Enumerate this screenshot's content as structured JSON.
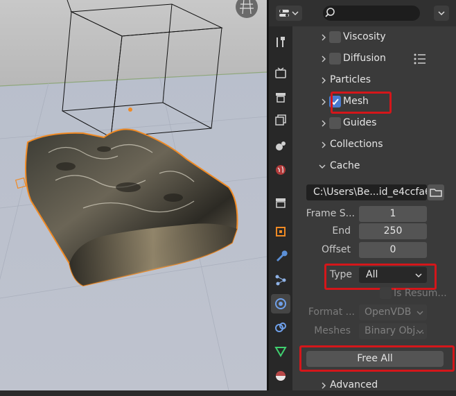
{
  "panel": {
    "sections": [
      {
        "label": "Viscosity",
        "checkbox": true
      },
      {
        "label": "Diffusion",
        "checkbox": true
      },
      {
        "label": "Particles",
        "checkbox": false
      },
      {
        "label": "Mesh",
        "checkbox": true,
        "checked": true
      },
      {
        "label": "Guides",
        "checkbox": true
      },
      {
        "label": "Collections",
        "checkbox": false
      },
      {
        "label": "Cache",
        "checkbox": false,
        "expanded": true
      }
    ],
    "cache": {
      "path": "C:\\Users\\Be...id_e4ccfa63",
      "frame_start_label": "Frame S...",
      "frame_start_value": "1",
      "end_label": "End",
      "end_value": "250",
      "offset_label": "Offset",
      "offset_value": "0",
      "type_label": "Type",
      "type_value": "All",
      "is_resumable_label": "Is Resum...",
      "format_label": "Format ...",
      "format_value": "OpenVDB",
      "meshes_label": "Meshes",
      "meshes_value": "Binary Obj...",
      "free_all_label": "Free All"
    },
    "advanced_label": "Advanced"
  },
  "tabs": [
    "tool-icon",
    "render-icon",
    "output-icon",
    "view-layer-icon",
    "scene-icon",
    "world-icon",
    "collection-icon",
    "object-icon",
    "modifier-icon",
    "particles-icon",
    "physics-icon",
    "constraints-icon",
    "data-icon",
    "material-icon"
  ],
  "colors": {
    "highlight": "#d4161a",
    "accent": "#4a7bd0",
    "selection": "#f08a24"
  }
}
